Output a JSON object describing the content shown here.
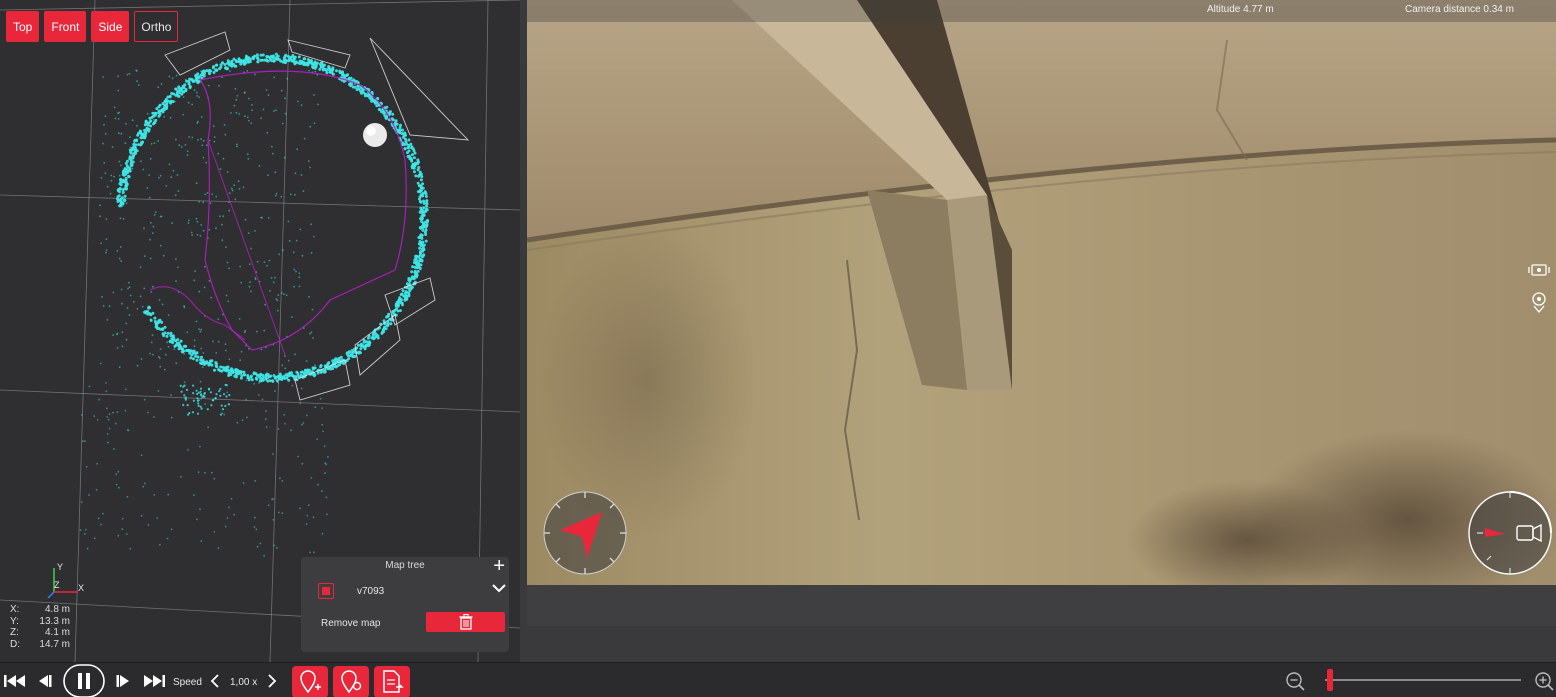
{
  "view_buttons": [
    {
      "label": "Top",
      "style": "filled"
    },
    {
      "label": "Front",
      "style": "filled"
    },
    {
      "label": "Side",
      "style": "filled"
    },
    {
      "label": "Ortho",
      "style": "outline"
    }
  ],
  "axis_labels": {
    "x": "X",
    "y": "Y",
    "z": "Z"
  },
  "coordinates": [
    {
      "label": "X:",
      "value": "4.8 m"
    },
    {
      "label": "Y:",
      "value": "13.3 m"
    },
    {
      "label": "Z:",
      "value": "4.1 m"
    },
    {
      "label": "D:",
      "value": "14.7 m"
    }
  ],
  "map_tree": {
    "title": "Map tree",
    "add_symbol": "+",
    "item_name": "v7093",
    "remove_label": "Remove map"
  },
  "camera": {
    "altitude": "Altitude 4.77 m",
    "camera_distance": "Camera distance 0.34 m"
  },
  "playback": {
    "speed_label": "Speed",
    "speed_value": "1,00 x"
  },
  "icons": {
    "skip_start": "skip-start-icon",
    "step_back": "step-back-icon",
    "pause": "pause-icon",
    "step_forward": "step-forward-icon",
    "skip_end": "skip-end-icon",
    "add_poi": "add-point-of-interest-icon",
    "add_poi_alt": "add-poi-variant-icon",
    "export_report": "export-report-icon",
    "zoom_out": "zoom-out-icon",
    "zoom_in": "zoom-in-icon",
    "trash": "trash-icon"
  },
  "colors": {
    "accent": "#e8283a",
    "point_cloud": "#3fe5e5",
    "trajectory": "#b41fc4"
  },
  "zoom_level": 0.02
}
